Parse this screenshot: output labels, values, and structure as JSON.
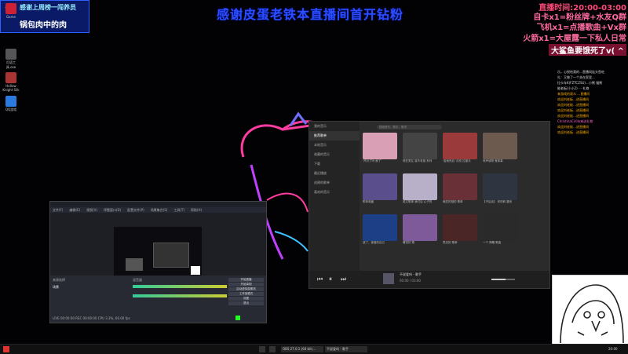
{
  "banner": "感谢皮蛋老铁本直播间首开钻粉",
  "badge": {
    "line1": "感谢上周榜一闯养员",
    "line2": "锅包肉中的肉"
  },
  "desktop_icons": [
    {
      "label": "Game",
      "color": "#c23"
    },
    {
      "label": "灯塔工具.exe",
      "color": "#555"
    },
    {
      "label": "Hollow Knight Silk",
      "color": "#a33"
    },
    {
      "label": "QQ游戏",
      "color": "#2a7be0"
    }
  ],
  "overlay": {
    "l1": "直播时间:20:00-03:00",
    "l2": "自卡x1=粉丝牌+水友Q群",
    "l3": "飞机x1=点播歌曲+Vx群",
    "l4": "火箭x1=大屋露一下私人日常",
    "l5": "大鲨鱼要饿死了v( ^"
  },
  "chat": [
    "乐，心悦给我的…直播间连头鱼吃",
    "扎：又做了一个关在家里…",
    "拉卡车K(FZTCZSU)…小熊 猫熊",
    "能老板(小小2) ⋯ 礼物",
    "来游戏的观众 …直播间",
    "欢迎刘老板…进直播间",
    "欢迎刘老板…进直播间",
    "欢迎刘老板…进直播间",
    "欢迎刘老板…进直播间",
    "ChristinaCirillo来送礼物",
    "欢迎刘老板…进直播间",
    "欢迎刘老板…进直播间"
  ],
  "obs": {
    "menu": [
      "文件(F)",
      "编辑(E)",
      "视图(V)",
      "停靠窗口(D)",
      "配置文件(P)",
      "场景集合(S)",
      "工具(T)",
      "帮助(H)"
    ],
    "scenes_title": "来源选择",
    "scene_item": "场景",
    "mixer_title": "混音器",
    "controls": [
      "开始直播",
      "开始录制",
      "启动虚拟摄像机",
      "工作室模式",
      "设置",
      "退出"
    ],
    "status": "LIVE 00:00:00  REC 00:00:00  CPU 3.3%, 60.00 fps"
  },
  "music": {
    "search_placeholder": "搜索音乐，歌手，歌词",
    "sidebar": [
      "我的音乐",
      "推荐歌单",
      "本地音乐",
      "收藏的音乐",
      "下载",
      "最近播放",
      "创建的歌单",
      "喜欢的音乐"
    ],
    "albums": [
      {
        "cap": "'开扒了吗 我了'",
        "color": "#d9a0b5"
      },
      {
        "cap": "现在男友 感不老感 系列",
        "color": "#444"
      },
      {
        "cap": "'若我死后' 月亮 拉普沃",
        "color": "#9a3a3a"
      },
      {
        "cap": "有声读物 鬼故事",
        "color": "#6b5a4d"
      },
      {
        "cap": "歌单收藏",
        "color": "#5a4e8c"
      },
      {
        "cap": "英文歌单 我们后 心子的",
        "color": "#b8b0c8"
      },
      {
        "cap": "暗恋的相的 歌单",
        "color": "#6a3038"
      },
      {
        "cap": "【不后谈】 你的和 集系",
        "color": "#2f3540"
      },
      {
        "cap": "放了，被爱的自己",
        "color": "#1d3f86"
      },
      {
        "cap": "睡觉的 歌",
        "color": "#7e5a9a"
      },
      {
        "cap": "思念的 歌单",
        "color": "#4a2626"
      },
      {
        "cap": "一个 神雕 歌曲",
        "color": "#2a2a2a"
      }
    ],
    "now_playing": "不说爱吗 - 歌手",
    "time": "00:00 / 03:00"
  },
  "taskbar": {
    "items": [
      "OBS 27.0.1 (64 bit)…",
      "不说爱吗 - 歌手"
    ],
    "clock": "20:00"
  },
  "colors": {
    "banner": "#2b4dff",
    "overlay": "#ff5a7a",
    "badge_bg": "#0a1a66"
  }
}
